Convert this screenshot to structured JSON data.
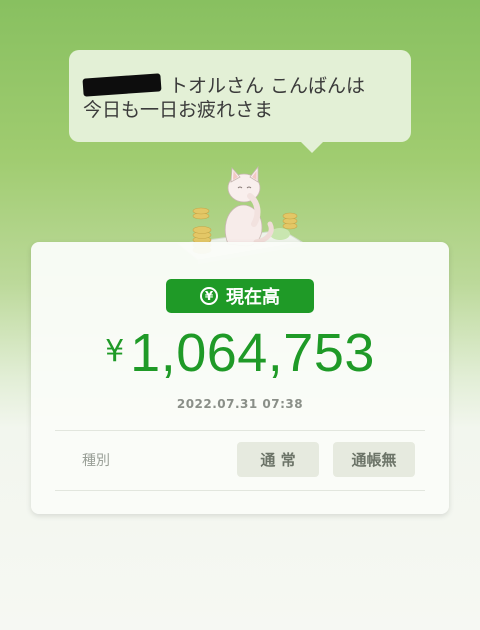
{
  "greeting": {
    "name_suffix": "トオルさん こんばんは",
    "line2": "今日も一日お疲れさま"
  },
  "balance": {
    "badge_icon": "yen-circle-icon",
    "badge_label": "現在高",
    "currency_symbol": "¥",
    "amount": "1,064,753",
    "timestamp": "2022.07.31 07:38"
  },
  "account_type": {
    "label": "種別",
    "options": [
      "通 常",
      "通帳無"
    ]
  },
  "colors": {
    "brand_green": "#1f9a27",
    "background_green": "#88c060"
  }
}
